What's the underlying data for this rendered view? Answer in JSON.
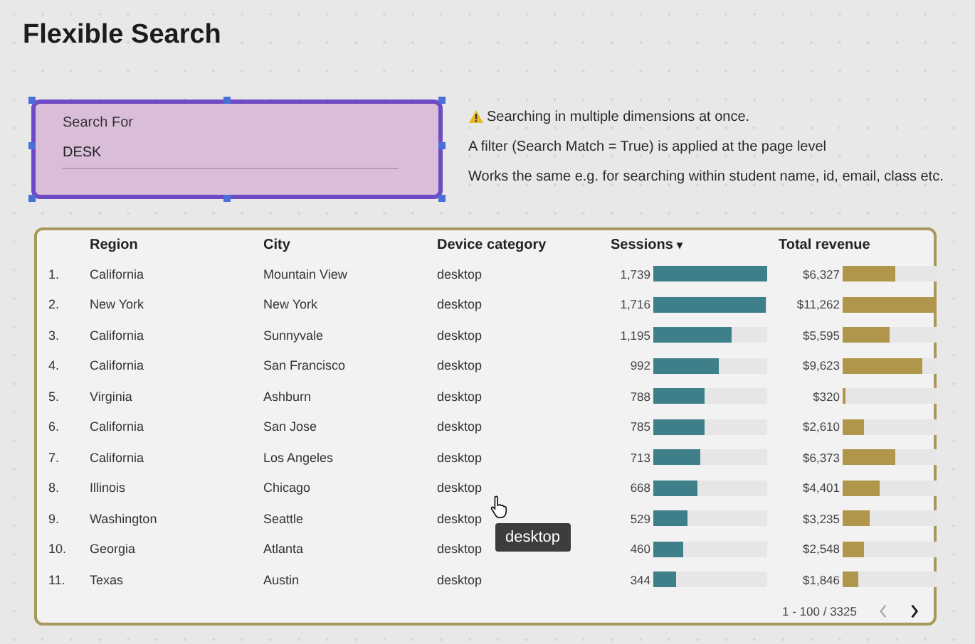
{
  "page_title": "Flexible Search",
  "search_control": {
    "label": "Search For",
    "value": "DESK",
    "selected": true
  },
  "notes": [
    {
      "text": "Searching in multiple dimensions at once.",
      "warning": true
    },
    {
      "text": "A filter (Search Match = True) is applied at the page level",
      "warning": false
    },
    {
      "text": "Works the same e.g. for searching within student name, id, email, class etc.",
      "warning": false
    }
  ],
  "table": {
    "columns": [
      "Region",
      "City",
      "Device category",
      "Sessions",
      "Total revenue"
    ],
    "sort_indicator": "▾",
    "rows": [
      {
        "index": "1.",
        "region": "California",
        "city": "Mountain View",
        "device": "desktop",
        "sessions": {
          "value": "1,739",
          "level": 1.0
        },
        "revenue": {
          "value": "$6,327",
          "level": 0.562
        }
      },
      {
        "index": "2.",
        "region": "New York",
        "city": "New York",
        "device": "desktop",
        "sessions": {
          "value": "1,716",
          "level": 0.987
        },
        "revenue": {
          "value": "$11,262",
          "level": 1.0
        }
      },
      {
        "index": "3.",
        "region": "California",
        "city": "Sunnyvale",
        "device": "desktop",
        "sessions": {
          "value": "1,195",
          "level": 0.687
        },
        "revenue": {
          "value": "$5,595",
          "level": 0.497
        }
      },
      {
        "index": "4.",
        "region": "California",
        "city": "San Francisco",
        "device": "desktop",
        "sessions": {
          "value": "992",
          "level": 0.57
        },
        "revenue": {
          "value": "$9,623",
          "level": 0.854
        }
      },
      {
        "index": "5.",
        "region": "Virginia",
        "city": "Ashburn",
        "device": "desktop",
        "sessions": {
          "value": "788",
          "level": 0.453
        },
        "revenue": {
          "value": "$320",
          "level": 0.028
        }
      },
      {
        "index": "6.",
        "region": "California",
        "city": "San Jose",
        "device": "desktop",
        "sessions": {
          "value": "785",
          "level": 0.451
        },
        "revenue": {
          "value": "$2,610",
          "level": 0.232
        }
      },
      {
        "index": "7.",
        "region": "California",
        "city": "Los Angeles",
        "device": "desktop",
        "sessions": {
          "value": "713",
          "level": 0.41
        },
        "revenue": {
          "value": "$6,373",
          "level": 0.566
        }
      },
      {
        "index": "8.",
        "region": "Illinois",
        "city": "Chicago",
        "device": "desktop",
        "sessions": {
          "value": "668",
          "level": 0.384
        },
        "revenue": {
          "value": "$4,401",
          "level": 0.391
        }
      },
      {
        "index": "9.",
        "region": "Washington",
        "city": "Seattle",
        "device": "desktop",
        "sessions": {
          "value": "529",
          "level": 0.304
        },
        "revenue": {
          "value": "$3,235",
          "level": 0.287
        }
      },
      {
        "index": "10.",
        "region": "Georgia",
        "city": "Atlanta",
        "device": "desktop",
        "sessions": {
          "value": "460",
          "level": 0.265
        },
        "revenue": {
          "value": "$2,548",
          "level": 0.226
        }
      },
      {
        "index": "11.",
        "region": "Texas",
        "city": "Austin",
        "device": "desktop",
        "sessions": {
          "value": "344",
          "level": 0.198
        },
        "revenue": {
          "value": "$1,846",
          "level": 0.164
        }
      }
    ],
    "pagination": {
      "range": "1 - 100 / 3325",
      "prev_disabled": true,
      "next_disabled": false
    },
    "tooltip": "desktop"
  }
}
